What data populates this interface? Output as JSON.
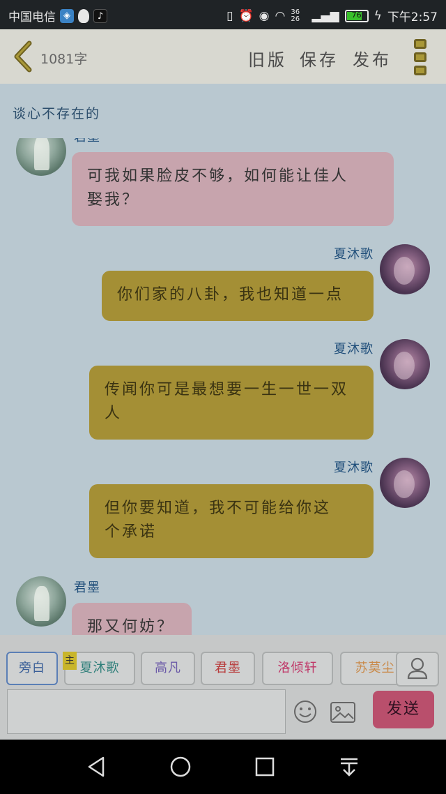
{
  "status_bar": {
    "carrier": "中国电信",
    "battery": "76",
    "time": "下午2:57",
    "network": "36 26",
    "icons": [
      "shield-icon",
      "qq-icon",
      "tiktok-icon",
      "vibrate-icon",
      "alarm-icon",
      "eye-icon",
      "wifi-icon",
      "signal-icon",
      "battery-icon",
      "charging-icon"
    ]
  },
  "header": {
    "word_count": "1081字",
    "old_version": "旧版",
    "save": "保存",
    "publish": "发布"
  },
  "story_title": "谈心不存在的",
  "messages": [
    {
      "speaker": "君墨",
      "side": "left",
      "style": "pink",
      "text_lines": [
        "可我如果脸皮不够，如何能让佳人",
        "娶我？"
      ]
    },
    {
      "speaker": "夏沐歌",
      "side": "right",
      "style": "gold",
      "text_lines": [
        "你们家的八卦，我也知道一点"
      ]
    },
    {
      "speaker": "夏沐歌",
      "side": "right",
      "style": "gold",
      "text_lines": [
        "传闻你可是最想要一生一世一双",
        "人"
      ]
    },
    {
      "speaker": "夏沐歌",
      "side": "right",
      "style": "gold",
      "text_lines": [
        "但你要知道，我不可能给你这",
        "个承诺"
      ]
    },
    {
      "speaker": "君墨",
      "side": "left",
      "style": "pink",
      "text_lines": [
        "那又何妨？"
      ]
    }
  ],
  "roles": [
    {
      "label": "旁白",
      "color": "#3a5f98",
      "active": true
    },
    {
      "label": "夏沐歌",
      "color": "#2f7f7a",
      "main": true
    },
    {
      "label": "高凡",
      "color": "#6b5aa8"
    },
    {
      "label": "君墨",
      "color": "#b83a3a"
    },
    {
      "label": "洛倾轩",
      "color": "#c03a6a"
    },
    {
      "label": "苏莫尘",
      "color": "#c98a4a"
    }
  ],
  "main_tag": "主",
  "input": {
    "placeholder": ""
  },
  "send_label": "发送",
  "colors": {
    "pink_bubble": "#c7a4ad",
    "gold_bubble": "#a48f35",
    "send_button": "#b94f6c",
    "speaker_name": "#1f4e7a"
  }
}
